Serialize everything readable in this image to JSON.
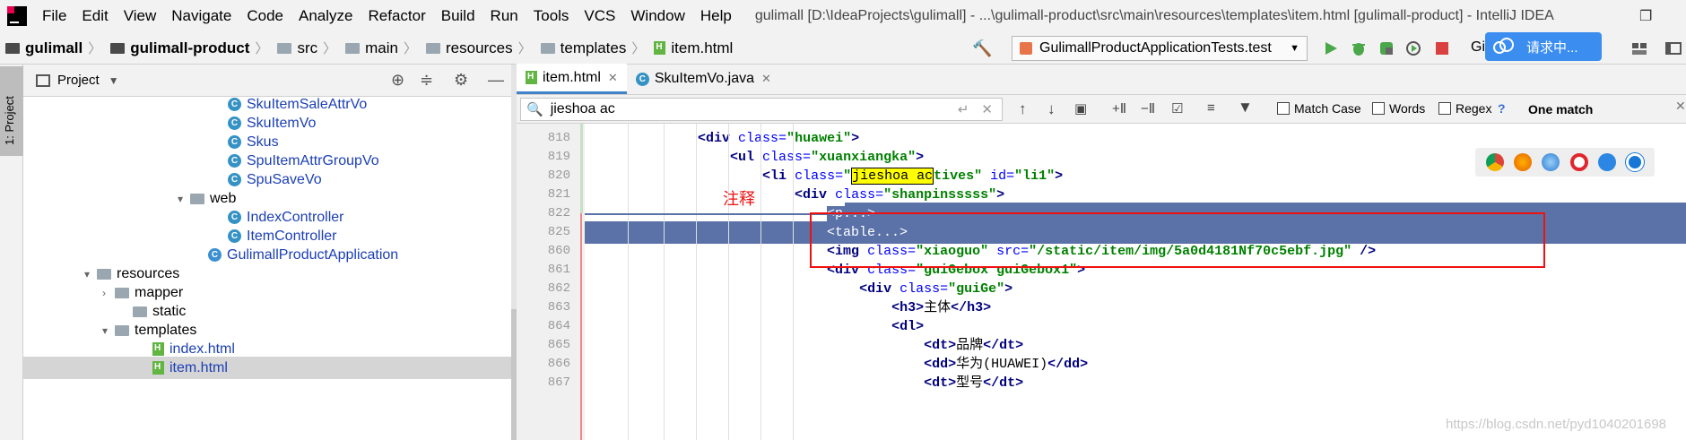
{
  "menubar": {
    "items": [
      "File",
      "Edit",
      "View",
      "Navigate",
      "Code",
      "Analyze",
      "Refactor",
      "Build",
      "Run",
      "Tools",
      "VCS",
      "Window",
      "Help"
    ],
    "title": "gulimall [D:\\IdeaProjects\\gulimall] - ...\\gulimall-product\\src\\main\\resources\\templates\\item.html [gulimall-product] - IntelliJ IDEA"
  },
  "breadcrumb": {
    "items": [
      "gulimall",
      "gulimall-product",
      "src",
      "main",
      "resources",
      "templates",
      "item.html"
    ]
  },
  "toolbar": {
    "run_config": "GulimallProductApplicationTests.test",
    "badge_text": "请求中...",
    "badge_prefix": "Gi"
  },
  "side_strip": {
    "label": "1: Project"
  },
  "project_panel": {
    "title": "Project",
    "rows": [
      {
        "label": "SkuItemSaleAttrVo",
        "kind": "class"
      },
      {
        "label": "SkuItemVo",
        "kind": "class"
      },
      {
        "label": "Skus",
        "kind": "class"
      },
      {
        "label": "SpuItemAttrGroupVo",
        "kind": "class"
      },
      {
        "label": "SpuSaveVo",
        "kind": "class"
      },
      {
        "label": "web",
        "kind": "package"
      },
      {
        "label": "IndexController",
        "kind": "class"
      },
      {
        "label": "ItemController",
        "kind": "class"
      },
      {
        "label": "GulimallProductApplication",
        "kind": "app"
      },
      {
        "label": "resources",
        "kind": "folder"
      },
      {
        "label": "mapper",
        "kind": "folder"
      },
      {
        "label": "static",
        "kind": "folder"
      },
      {
        "label": "templates",
        "kind": "folder"
      },
      {
        "label": "index.html",
        "kind": "html"
      },
      {
        "label": "item.html",
        "kind": "html"
      }
    ]
  },
  "editor": {
    "tabs": [
      {
        "label": "item.html",
        "active": true
      },
      {
        "label": "SkuItemVo.java",
        "active": false
      }
    ],
    "find": {
      "query": "jieshoa ac",
      "match_case": "Match Case",
      "words": "Words",
      "regex": "Regex",
      "regex_help": "?",
      "result": "One match"
    },
    "lines": [
      {
        "num": "818",
        "indent": "      ",
        "parts": [
          [
            "tag",
            "<div "
          ],
          [
            "attr",
            "class="
          ],
          [
            "val",
            "\"huawei\""
          ],
          [
            "tag",
            ">"
          ]
        ]
      },
      {
        "num": "819",
        "indent": "        ",
        "parts": [
          [
            "tag",
            "<ul "
          ],
          [
            "attr",
            "class="
          ],
          [
            "val",
            "\"xuanxiangka\""
          ],
          [
            "tag",
            ">"
          ]
        ]
      },
      {
        "num": "820",
        "indent": "          ",
        "parts": [
          [
            "tag",
            "<li "
          ],
          [
            "attr",
            "class="
          ],
          [
            "val",
            "\""
          ],
          [
            "hl",
            "jieshoa ac"
          ],
          [
            "val",
            "tives\""
          ],
          [
            "attr",
            " id="
          ],
          [
            "val",
            "\"li1\""
          ],
          [
            "tag",
            ">"
          ]
        ]
      },
      {
        "num": "821",
        "indent": "            ",
        "parts": [
          [
            "tag",
            "<div "
          ],
          [
            "attr",
            "class="
          ],
          [
            "val",
            "\"shanpinsssss\""
          ],
          [
            "tag",
            ">"
          ]
        ]
      },
      {
        "num": "822",
        "indent": "              ",
        "parts": [
          [
            "sel",
            "<p...>"
          ]
        ]
      },
      {
        "num": "825",
        "indent": "              ",
        "parts": [
          [
            "sel",
            "<table...>"
          ]
        ]
      },
      {
        "num": "860",
        "indent": "              ",
        "parts": [
          [
            "tag",
            "<img "
          ],
          [
            "attr",
            "class="
          ],
          [
            "val",
            "\"xiaoguo\""
          ],
          [
            "attr",
            " src="
          ],
          [
            "val",
            "\"/static/item/img/5a0d4181Nf70c5ebf.jpg\""
          ],
          [
            "tag",
            " />"
          ]
        ]
      },
      {
        "num": "861",
        "indent": "              ",
        "parts": [
          [
            "tag",
            "<div "
          ],
          [
            "attr",
            "class="
          ],
          [
            "val",
            "\"guiGebox guiGebox1\""
          ],
          [
            "tag",
            ">"
          ]
        ]
      },
      {
        "num": "862",
        "indent": "                ",
        "parts": [
          [
            "tag",
            "<div "
          ],
          [
            "attr",
            "class="
          ],
          [
            "val",
            "\"guiGe\""
          ],
          [
            "tag",
            ">"
          ]
        ]
      },
      {
        "num": "863",
        "indent": "                  ",
        "parts": [
          [
            "tag",
            "<h3>"
          ],
          [
            "txt",
            "主体"
          ],
          [
            "tag",
            "</h3>"
          ]
        ]
      },
      {
        "num": "864",
        "indent": "                  ",
        "parts": [
          [
            "tag",
            "<dl>"
          ]
        ]
      },
      {
        "num": "865",
        "indent": "                    ",
        "parts": [
          [
            "tag",
            "<dt>"
          ],
          [
            "txt",
            "品牌"
          ],
          [
            "tag",
            "</dt>"
          ]
        ]
      },
      {
        "num": "866",
        "indent": "                    ",
        "parts": [
          [
            "tag",
            "<dd>"
          ],
          [
            "txt",
            "华为(HUAWEI)"
          ],
          [
            "tag",
            "</dd>"
          ]
        ]
      },
      {
        "num": "867",
        "indent": "                    ",
        "parts": [
          [
            "tag",
            "<dt>"
          ],
          [
            "txt",
            "型号"
          ],
          [
            "tag",
            "</dt>"
          ]
        ]
      }
    ],
    "annotation": "注释"
  },
  "watermark": "https://blog.csdn.net/pyd1040201698",
  "colors": {
    "selection": "#5b72a8",
    "annotation_red": "#e11111",
    "find_highlight": "#ffff00"
  }
}
